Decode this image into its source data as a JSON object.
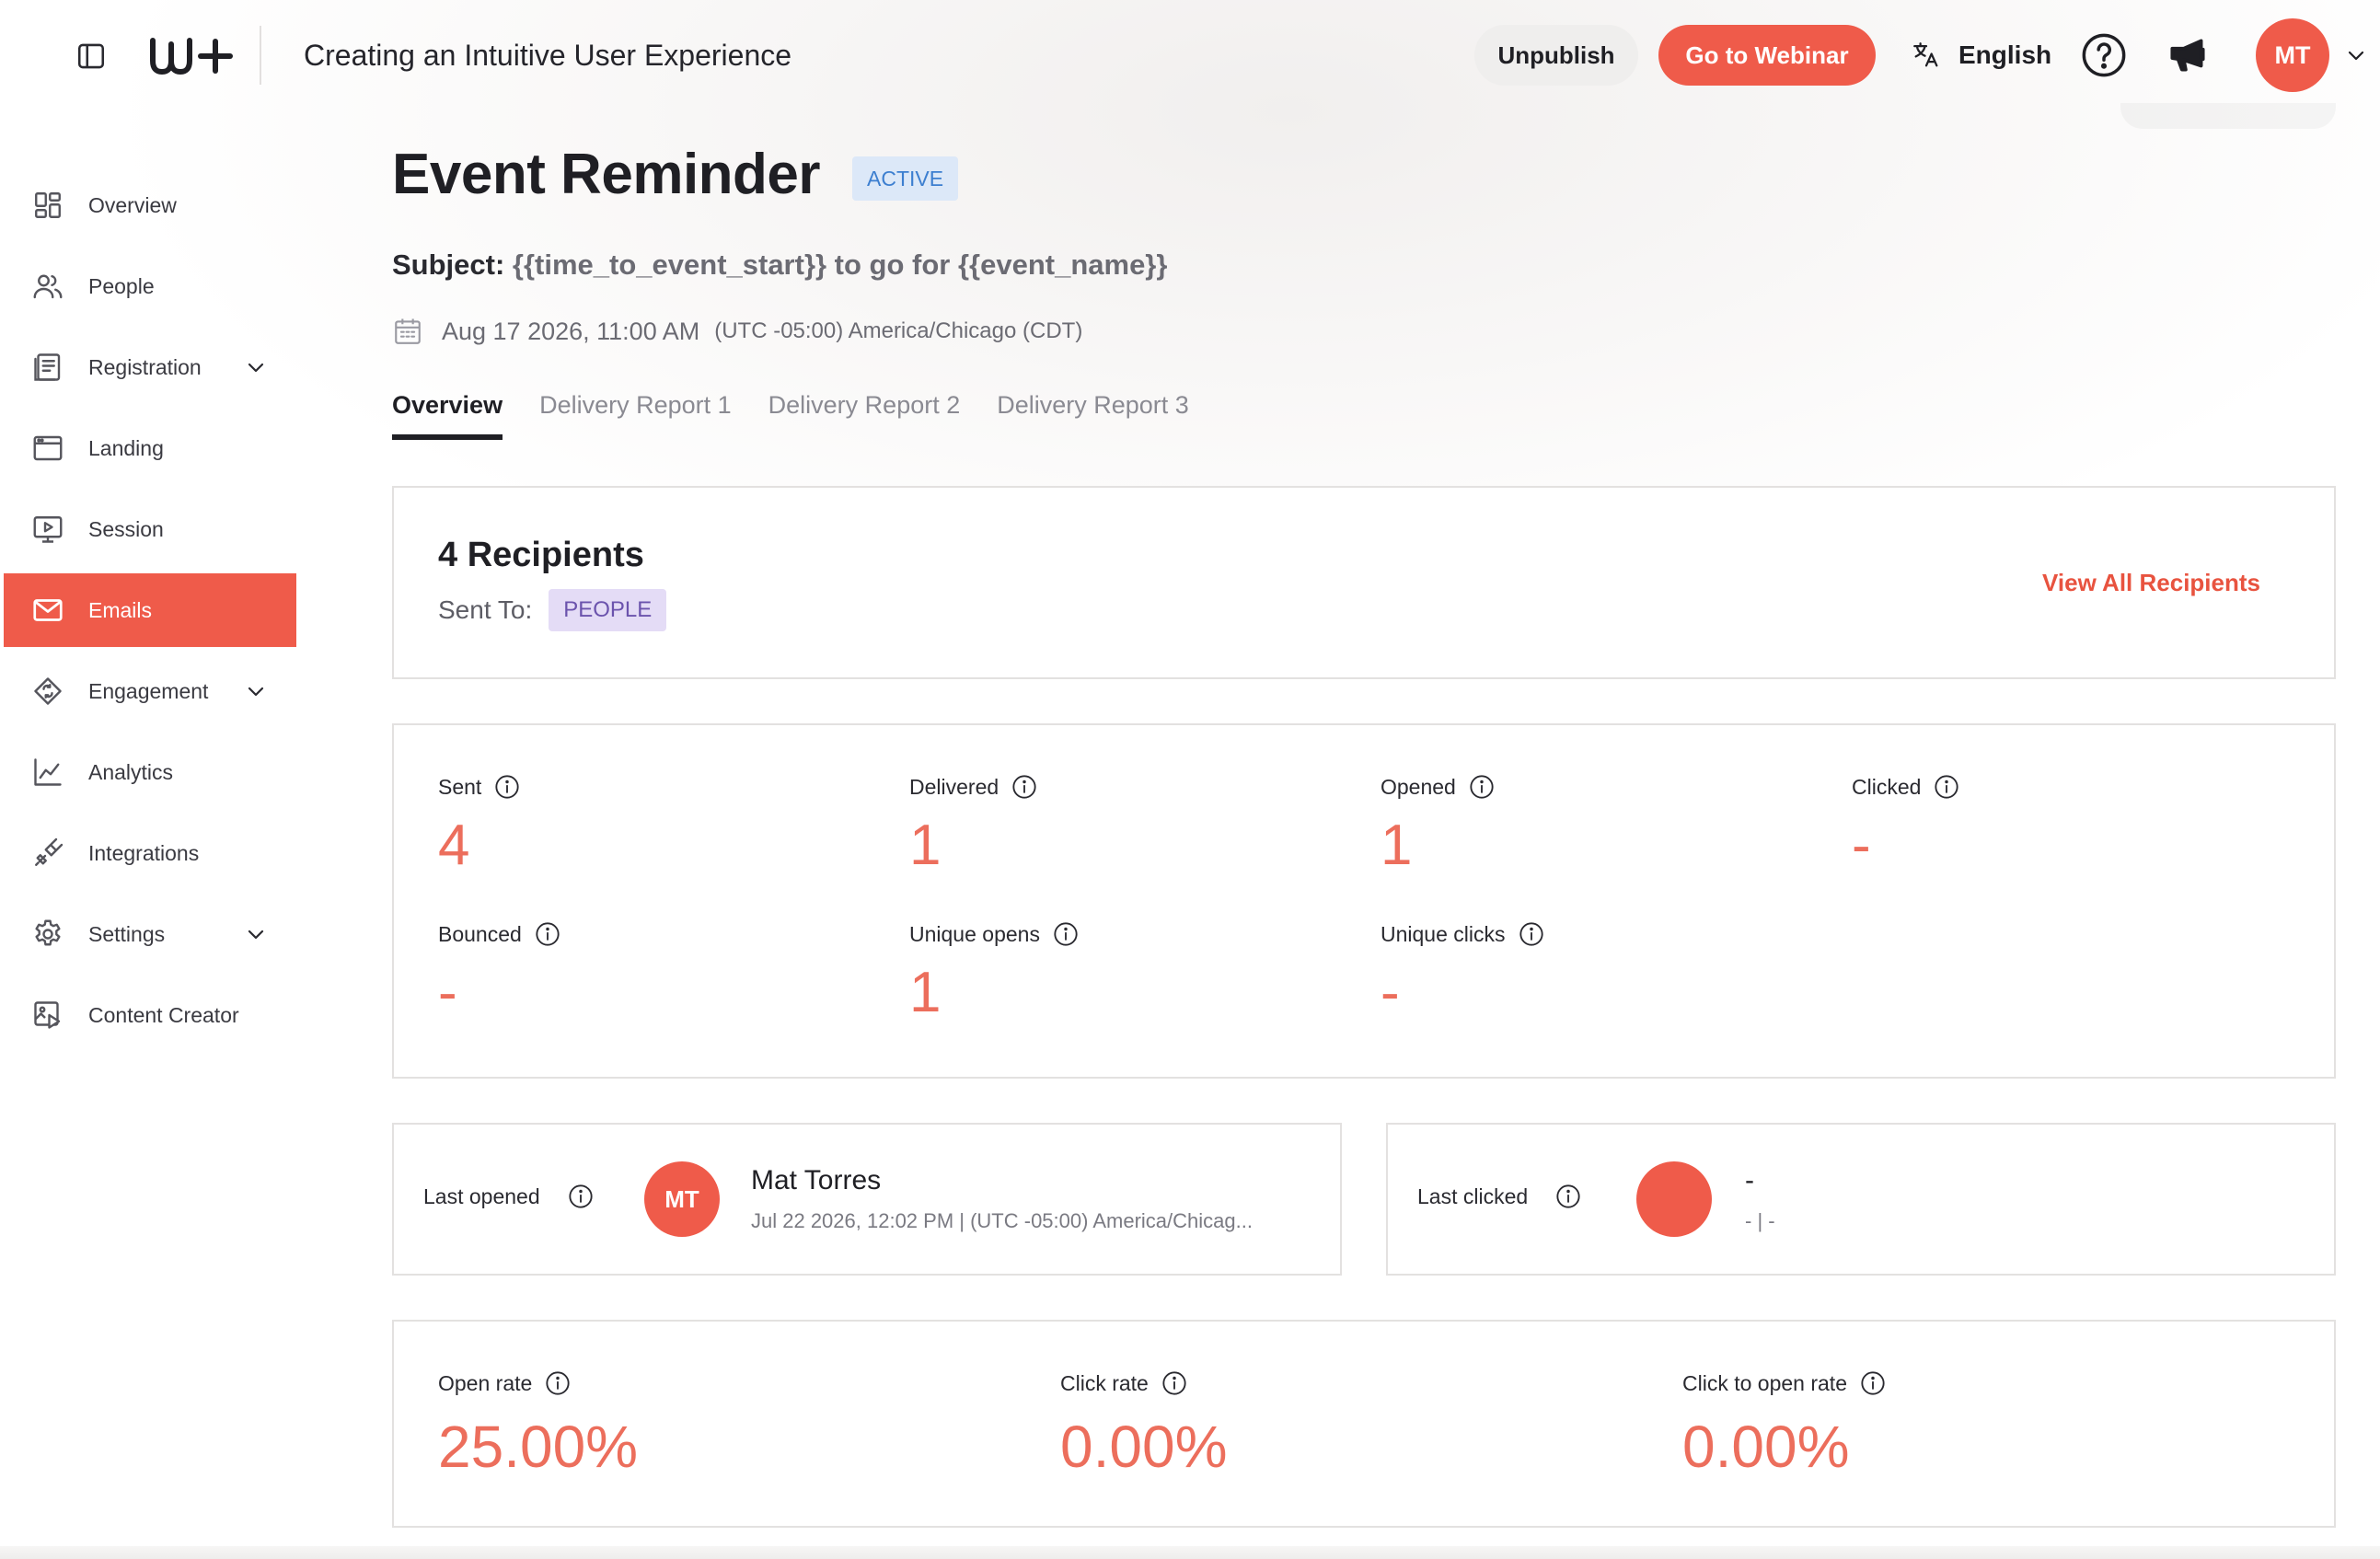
{
  "header": {
    "page_heading": "Creating an Intuitive User Experience",
    "unpublish_label": "Unpublish",
    "go_to_webinar_label": "Go to Webinar",
    "language": "English",
    "avatar_initials": "MT",
    "icons": [
      "sidebar-toggle-icon",
      "logo",
      "translate-icon",
      "help-icon",
      "megaphone-icon",
      "chevron-down-icon"
    ]
  },
  "sidebar": {
    "items": [
      {
        "label": "Overview",
        "icon": "grid-icon",
        "expandable": false,
        "active": false
      },
      {
        "label": "People",
        "icon": "people-icon",
        "expandable": false,
        "active": false
      },
      {
        "label": "Registration",
        "icon": "form-icon",
        "expandable": true,
        "active": false
      },
      {
        "label": "Landing",
        "icon": "browser-icon",
        "expandable": false,
        "active": false
      },
      {
        "label": "Session",
        "icon": "monitor-play-icon",
        "expandable": false,
        "active": false
      },
      {
        "label": "Emails",
        "icon": "mail-icon",
        "expandable": false,
        "active": true
      },
      {
        "label": "Engagement",
        "icon": "engagement-icon",
        "expandable": true,
        "active": false
      },
      {
        "label": "Analytics",
        "icon": "chart-line-icon",
        "expandable": false,
        "active": false
      },
      {
        "label": "Integrations",
        "icon": "plug-icon",
        "expandable": false,
        "active": false
      },
      {
        "label": "Settings",
        "icon": "gear-icon",
        "expandable": true,
        "active": false
      },
      {
        "label": "Content Creator",
        "icon": "image-play-icon",
        "expandable": false,
        "active": false
      }
    ]
  },
  "email": {
    "title": "Event Reminder",
    "status": "ACTIVE",
    "subject_label": "Subject:",
    "subject_value": "{{time_to_event_start}} to go for {{event_name}}",
    "date": "Aug 17 2026, 11:00 AM",
    "timezone": "(UTC -05:00) America/Chicago (CDT)"
  },
  "tabs": [
    {
      "label": "Overview",
      "active": true
    },
    {
      "label": "Delivery Report 1",
      "active": false
    },
    {
      "label": "Delivery Report 2",
      "active": false
    },
    {
      "label": "Delivery Report 3",
      "active": false
    }
  ],
  "recipients": {
    "title": "4 Recipients",
    "sent_to_label": "Sent To:",
    "sent_to_value": "PEOPLE",
    "view_all_label": "View All Recipients"
  },
  "stats": {
    "sent": {
      "label": "Sent",
      "value": "4"
    },
    "delivered": {
      "label": "Delivered",
      "value": "1"
    },
    "opened": {
      "label": "Opened",
      "value": "1"
    },
    "clicked": {
      "label": "Clicked",
      "value": "-"
    },
    "bounced": {
      "label": "Bounced",
      "value": "-"
    },
    "unique_opens": {
      "label": "Unique opens",
      "value": "1"
    },
    "unique_clicks": {
      "label": "Unique clicks",
      "value": "-"
    }
  },
  "last_opened": {
    "label": "Last opened",
    "initials": "MT",
    "name": "Mat Torres",
    "meta": "Jul 22 2026, 12:02 PM | (UTC -05:00) America/Chicag..."
  },
  "last_clicked": {
    "label": "Last clicked",
    "name": "-",
    "meta": "- | -"
  },
  "rates": {
    "open_rate": {
      "label": "Open rate",
      "value": "25.00%"
    },
    "click_rate": {
      "label": "Click rate",
      "value": "0.00%"
    },
    "click_to_open_rate": {
      "label": "Click to open rate",
      "value": "0.00%"
    }
  },
  "colors": {
    "accent": "#ef5b4a",
    "stat_value": "#ec6e5c",
    "active_badge_bg": "#dce8f8",
    "people_badge_bg": "#e4dcf6"
  }
}
